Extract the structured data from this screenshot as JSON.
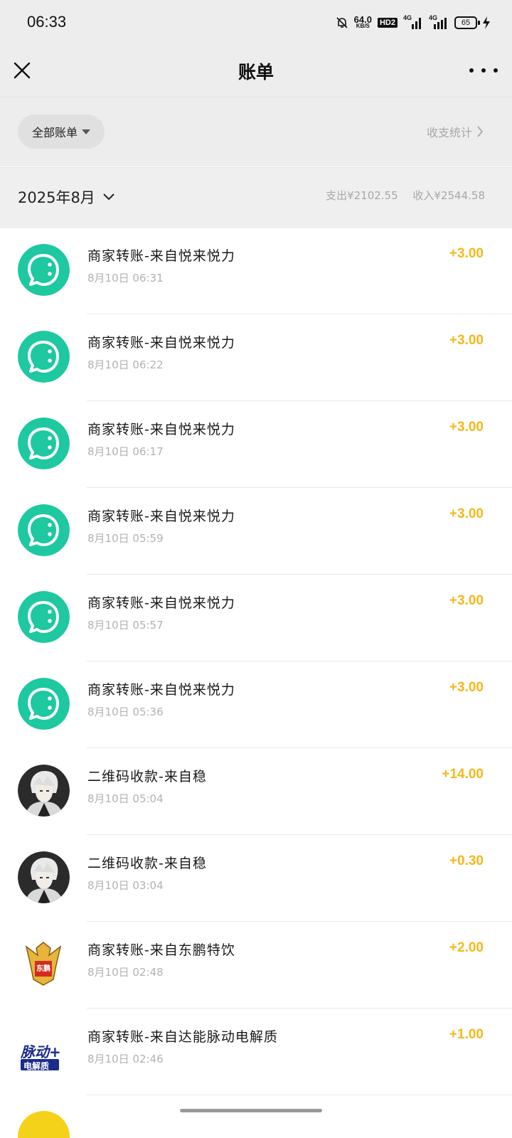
{
  "status_bar": {
    "time": "06:33",
    "net_speed_value": "64.0",
    "net_speed_unit": "KB/S",
    "hd_label": "HD2",
    "signal1_label": "4G",
    "signal2_label": "4G",
    "battery": "65"
  },
  "nav": {
    "title": "账单"
  },
  "filter": {
    "chip_label": "全部账单",
    "stats_label": "收支统计"
  },
  "month": {
    "label": "2025年8月",
    "expense": "支出¥2102.55",
    "income": "收入¥2544.58"
  },
  "colors": {
    "amount": "#f5b71a",
    "merchant_avatar": "#1ec8a0",
    "background_gray": "#ededed"
  },
  "transactions": [
    {
      "title": "商家转账-来自悦来悦力",
      "time": "8月10日 06:31",
      "amount": "+3.00",
      "avatar": "chat-bubble-icon"
    },
    {
      "title": "商家转账-来自悦来悦力",
      "time": "8月10日 06:22",
      "amount": "+3.00",
      "avatar": "chat-bubble-icon"
    },
    {
      "title": "商家转账-来自悦来悦力",
      "time": "8月10日 06:17",
      "amount": "+3.00",
      "avatar": "chat-bubble-icon"
    },
    {
      "title": "商家转账-来自悦来悦力",
      "time": "8月10日 05:59",
      "amount": "+3.00",
      "avatar": "chat-bubble-icon"
    },
    {
      "title": "商家转账-来自悦来悦力",
      "time": "8月10日 05:57",
      "amount": "+3.00",
      "avatar": "chat-bubble-icon"
    },
    {
      "title": "商家转账-来自悦来悦力",
      "time": "8月10日 05:36",
      "amount": "+3.00",
      "avatar": "chat-bubble-icon"
    },
    {
      "title": "二维码收款-来自稳",
      "time": "8月10日 05:04",
      "amount": "+14.00",
      "avatar": "user-photo"
    },
    {
      "title": "二维码收款-来自稳",
      "time": "8月10日 03:04",
      "amount": "+0.30",
      "avatar": "user-photo"
    },
    {
      "title": "商家转账-来自东鹏特饮",
      "time": "8月10日 02:48",
      "amount": "+2.00",
      "avatar": "dongpeng-logo"
    },
    {
      "title": "商家转账-来自达能脉动电解质",
      "time": "8月10日 02:46",
      "amount": "+1.00",
      "avatar": "mizone-logo"
    }
  ],
  "logos": {
    "dongpeng_text": "东鹏",
    "mizone_line1": "脉动+",
    "mizone_line2": "电解质"
  }
}
